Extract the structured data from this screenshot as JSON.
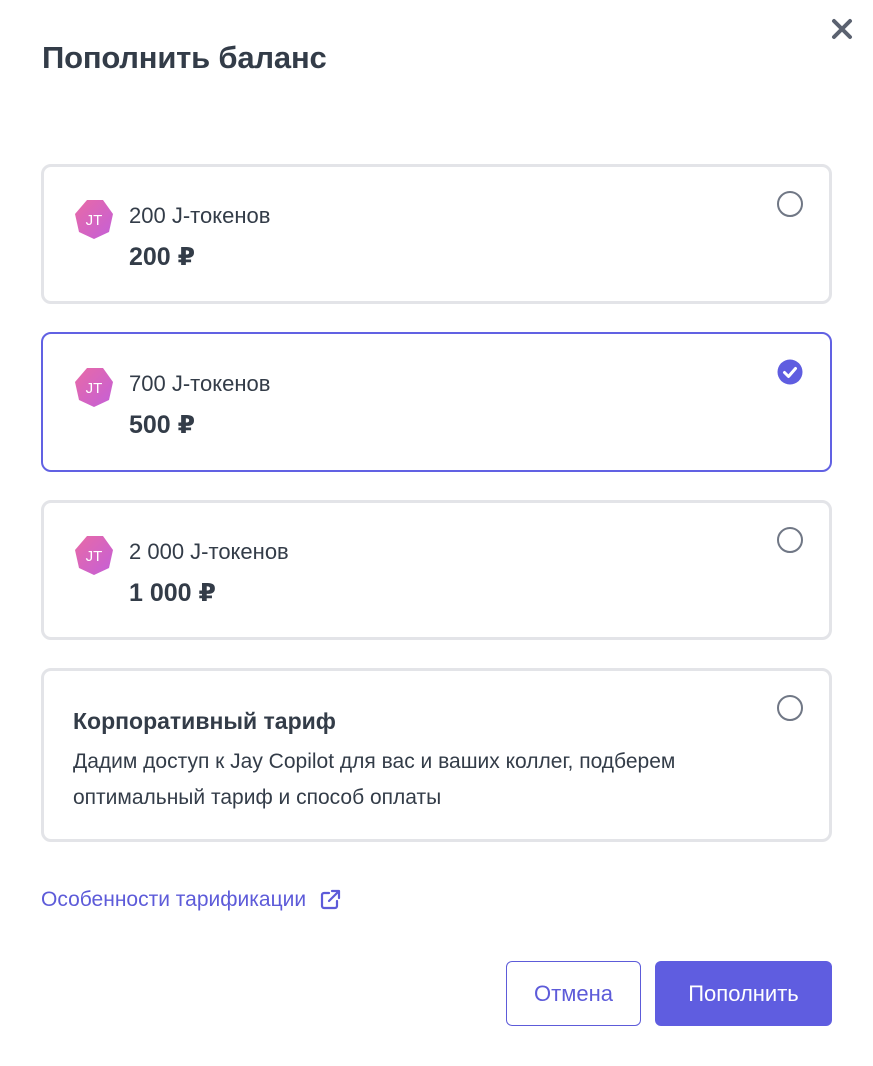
{
  "dialog": {
    "title": "Пополнить баланс",
    "close_icon": "close-icon"
  },
  "options": [
    {
      "badge": "JT",
      "amount": "200 J-токенов",
      "price": "200 ₽",
      "selected": false
    },
    {
      "badge": "JT",
      "amount": "700 J-токенов",
      "price": "500 ₽",
      "selected": true
    },
    {
      "badge": "JT",
      "amount": "2 000 J-токенов",
      "price": "1 000 ₽",
      "selected": false
    }
  ],
  "corporate": {
    "title": "Корпоративный тариф",
    "description": "Дадим доступ к Jay Copilot для вас и ваших коллег, подберем оптимальный тариф и способ оплаты",
    "selected": false
  },
  "billing_link": {
    "label": "Особенности тарификации",
    "icon": "external-link-icon"
  },
  "buttons": {
    "cancel": "Отмена",
    "submit": "Пополнить"
  },
  "colors": {
    "accent": "#5f5de0",
    "link": "#5d5bd9",
    "text": "#333c48",
    "border": "#e3e4e8",
    "badge_gradient_start": "#e86aa6",
    "badge_gradient_end": "#c45fd8"
  }
}
